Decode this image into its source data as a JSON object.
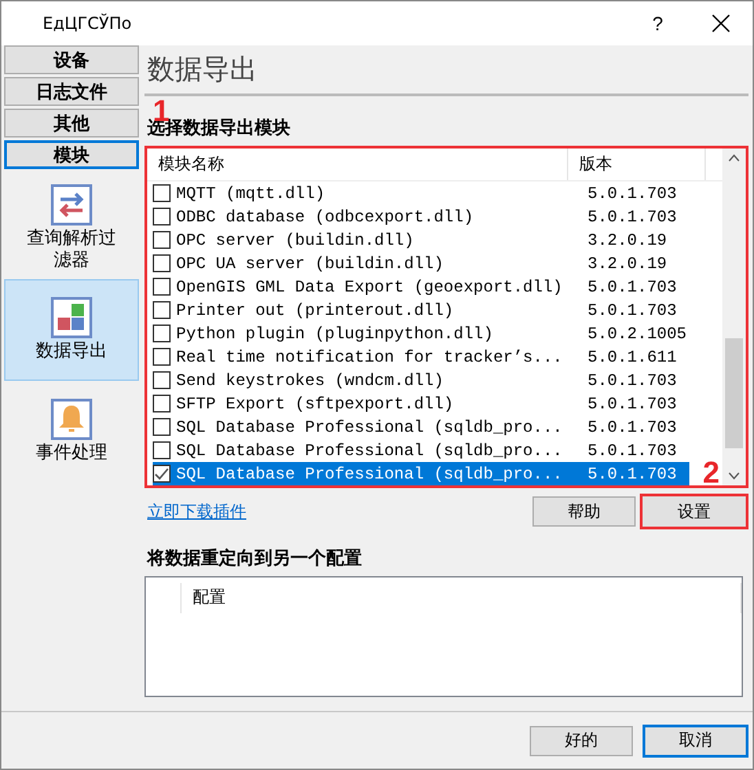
{
  "window": {
    "title": "ЕдЦГСЎПо",
    "help": "?"
  },
  "sidebar": {
    "tabs": [
      {
        "label": "设备",
        "selected": false
      },
      {
        "label": "日志文件",
        "selected": false
      },
      {
        "label": "其他",
        "selected": false
      },
      {
        "label": "模块",
        "selected": true
      }
    ],
    "items": [
      {
        "label": "查询解析过滤器",
        "kind": "filter",
        "selected": false
      },
      {
        "label": "数据导出",
        "kind": "export",
        "selected": true
      },
      {
        "label": "事件处理",
        "kind": "events",
        "selected": false
      }
    ]
  },
  "page": {
    "title": "数据导出",
    "section": "选择数据导出模块",
    "table": {
      "columns": [
        "模块名称",
        "版本"
      ],
      "rows": [
        {
          "name": "MQTT (mqtt.dll)",
          "version": "5.0.1.703",
          "checked": false,
          "selected": false
        },
        {
          "name": "ODBC database (odbcexport.dll)",
          "version": "5.0.1.703",
          "checked": false,
          "selected": false
        },
        {
          "name": "OPC server (buildin.dll)",
          "version": "3.2.0.19",
          "checked": false,
          "selected": false
        },
        {
          "name": "OPC UA server (buildin.dll)",
          "version": "3.2.0.19",
          "checked": false,
          "selected": false
        },
        {
          "name": "OpenGIS GML Data Export (geoexport.dll)",
          "version": "5.0.1.703",
          "checked": false,
          "selected": false
        },
        {
          "name": "Printer out (printerout.dll)",
          "version": "5.0.1.703",
          "checked": false,
          "selected": false
        },
        {
          "name": "Python plugin (pluginpython.dll)",
          "version": "5.0.2.1005",
          "checked": false,
          "selected": false
        },
        {
          "name": "Real time notification for tracker’s...",
          "version": "5.0.1.611",
          "checked": false,
          "selected": false
        },
        {
          "name": "Send keystrokes (wndcm.dll)",
          "version": "5.0.1.703",
          "checked": false,
          "selected": false
        },
        {
          "name": "SFTP Export (sftpexport.dll)",
          "version": "5.0.1.703",
          "checked": false,
          "selected": false
        },
        {
          "name": "SQL Database Professional (sqldb_pro...",
          "version": "5.0.1.703",
          "checked": false,
          "selected": false
        },
        {
          "name": "SQL Database Professional (sqldb_pro...",
          "version": "5.0.1.703",
          "checked": false,
          "selected": false
        },
        {
          "name": "SQL Database Professional (sqldb_pro...",
          "version": "5.0.1.703",
          "checked": true,
          "selected": true
        }
      ]
    },
    "download_link": "立即下载插件",
    "help_button": "帮助",
    "settings_button": "设置",
    "redirect_section": "将数据重定向到另一个配置",
    "redirect_table": {
      "columns": [
        "配置"
      ]
    }
  },
  "annotations": [
    "1",
    "2"
  ],
  "buttons": [
    "好的",
    "取消"
  ]
}
